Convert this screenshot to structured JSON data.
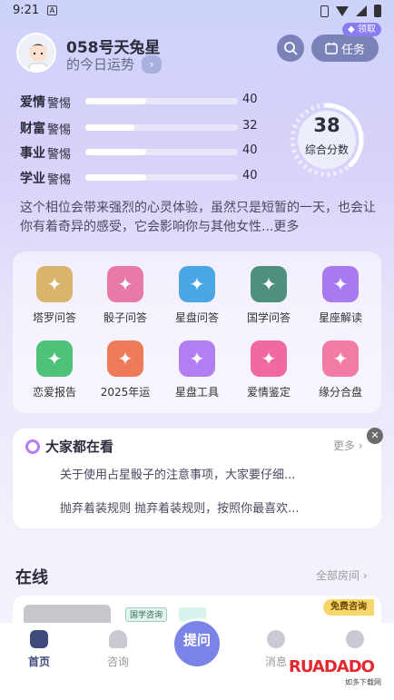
{
  "status_bar": {
    "time": "9:21",
    "app_badge": "A"
  },
  "profile": {
    "username": "058号天兔星",
    "fortune_link": "的今日运势"
  },
  "header": {
    "claim_tag": "领取",
    "task_label": "任务"
  },
  "metrics": [
    {
      "name": "爱情",
      "level": "警惕",
      "value": "40",
      "progress": 0.4
    },
    {
      "name": "财富",
      "level": "警惕",
      "value": "32",
      "progress": 0.32
    },
    {
      "name": "事业",
      "level": "警惕",
      "value": "40",
      "progress": 0.4
    },
    {
      "name": "学业",
      "level": "警惕",
      "value": "40",
      "progress": 0.4
    }
  ],
  "score": {
    "value": "38",
    "label": "综合分数",
    "progress": 0.38
  },
  "description": {
    "text": "这个相位会带来强烈的心灵体验，虽然只是短暂的一天，也会让你有着奇异的感受，它会影响你与其他女性...",
    "more": "更多"
  },
  "tools": [
    {
      "label": "塔罗问答",
      "icon": "tarot-icon",
      "color": "#d9b46c"
    },
    {
      "label": "骰子问答",
      "icon": "dice-icon",
      "color": "#e77aa8"
    },
    {
      "label": "星盘问答",
      "icon": "astrolabe-icon",
      "color": "#4ba6e6"
    },
    {
      "label": "国学问答",
      "icon": "book-icon",
      "color": "#4e8f7d"
    },
    {
      "label": "星座解读",
      "icon": "constellation-icon",
      "color": "#a77af0"
    },
    {
      "label": "恋爱报告",
      "icon": "love-report-icon",
      "color": "#4fc27a"
    },
    {
      "label": "2025年运",
      "icon": "yinyang-icon",
      "color": "#ef7a5a"
    },
    {
      "label": "星盘工具",
      "icon": "clipboard-icon",
      "color": "#b27ff2"
    },
    {
      "label": "爱情鉴定",
      "icon": "heart-icon",
      "color": "#f06aa0"
    },
    {
      "label": "缘分合盘",
      "icon": "heart-bubble-icon",
      "color": "#f27ca6"
    }
  ],
  "hot": {
    "title": "大家都在看",
    "more": "更多",
    "items": [
      "关于使用占星骰子的注意事项，大家要仔细...",
      "抛弃着装规则 抛弃着装规则，按照你最喜欢..."
    ]
  },
  "online": {
    "title": "在线",
    "rooms_link": "全部房间",
    "room_tag": "国学咨询",
    "free_tag": "免费咨询"
  },
  "tabbar": {
    "home": "首页",
    "consult": "咨询",
    "ask": "提问",
    "messages": "消息",
    "accent": "#7a84e6"
  },
  "watermark": {
    "brand": "RUADADO",
    "sub": "如多下载网"
  }
}
